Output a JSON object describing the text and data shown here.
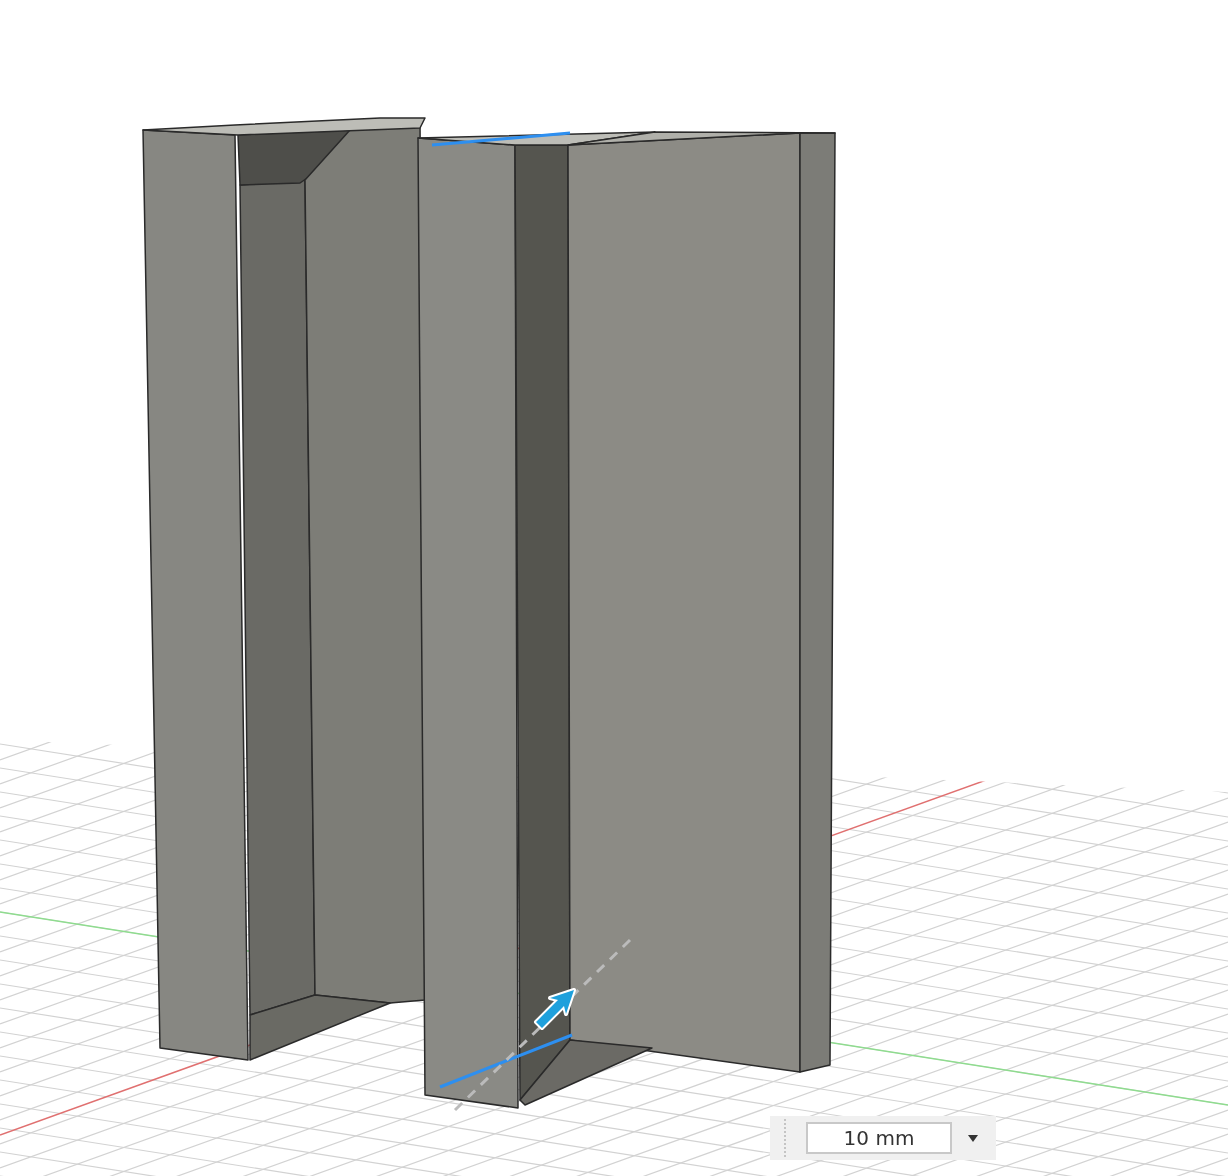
{
  "dimension_input": {
    "value": "10 mm"
  }
}
